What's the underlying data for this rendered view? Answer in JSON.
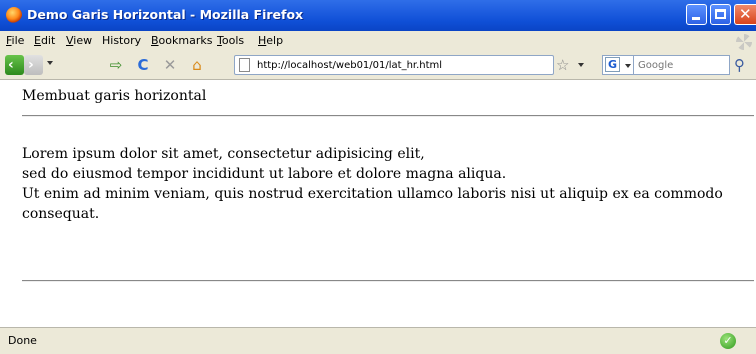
{
  "window": {
    "title": "Demo Garis Horizontal - Mozilla Firefox",
    "controls": {
      "minimize_icon": "minimize-icon",
      "maximize_icon": "maximize-icon",
      "close_icon": "close-icon",
      "close_glyph": "✕"
    }
  },
  "menu": {
    "items": [
      {
        "first": "F",
        "rest": "ile"
      },
      {
        "first": "E",
        "rest": "dit"
      },
      {
        "first": "V",
        "rest": "iew"
      },
      {
        "first": "",
        "rest": "History"
      },
      {
        "first": "B",
        "rest": "ookmarks"
      },
      {
        "first": "T",
        "rest": "ools"
      },
      {
        "first": "H",
        "rest": "elp"
      }
    ]
  },
  "toolbar": {
    "back_glyph": "‹",
    "forward_glyph": "›",
    "reload_glyph": "C",
    "stop_glyph": "✕",
    "home_glyph": "⌂",
    "rss_glyph": "⇨",
    "url": "http://localhost/web01/01/lat_hr.html",
    "star_glyph": "☆",
    "search_engine_glyph": "G",
    "search_placeholder": "Google",
    "search_go_glyph": "⚲"
  },
  "page": {
    "heading": "Membuat garis horizontal",
    "paragraph_lines": [
      "Lorem ipsum dolor sit amet, consectetur adipisicing elit,",
      "sed do eiusmod tempor incididunt ut labore et dolore magna aliqua.",
      "Ut enim ad minim veniam, quis nostrud exercitation ullamco laboris nisi ut aliquip ex ea commodo",
      "consequat."
    ]
  },
  "status": {
    "text": "Done",
    "ok_glyph": "✓"
  },
  "colors": {
    "titlebar_blue": "#0f4fd6",
    "chrome_beige": "#ece9d8",
    "back_green": "#2d8a1d",
    "close_red": "#d8431c"
  }
}
